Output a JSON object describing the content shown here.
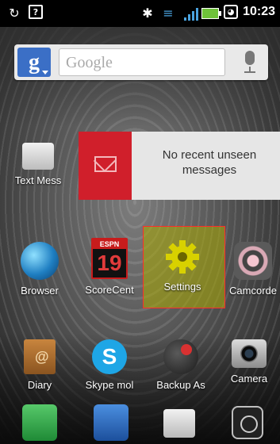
{
  "status_bar": {
    "time": "10:23"
  },
  "search": {
    "placeholder": "Google",
    "google_badge": "g"
  },
  "notification": {
    "text": "No recent unseen messages"
  },
  "apps_row1": [
    {
      "label": "Text Mess"
    }
  ],
  "apps_row2": [
    {
      "label": "Browser"
    },
    {
      "label": "ScoreCent"
    },
    {
      "label": "Settings"
    },
    {
      "label": "Camcorde"
    }
  ],
  "apps_row3": [
    {
      "label": "Diary"
    },
    {
      "label": "Skype mol"
    },
    {
      "label": "Backup As"
    },
    {
      "label": "Camera"
    }
  ],
  "scorecenter_badge": "ESPN",
  "scorecenter_number": "19",
  "colors": {
    "accent_red": "#d01f2b",
    "selection_yellow": "#aaaa00"
  }
}
